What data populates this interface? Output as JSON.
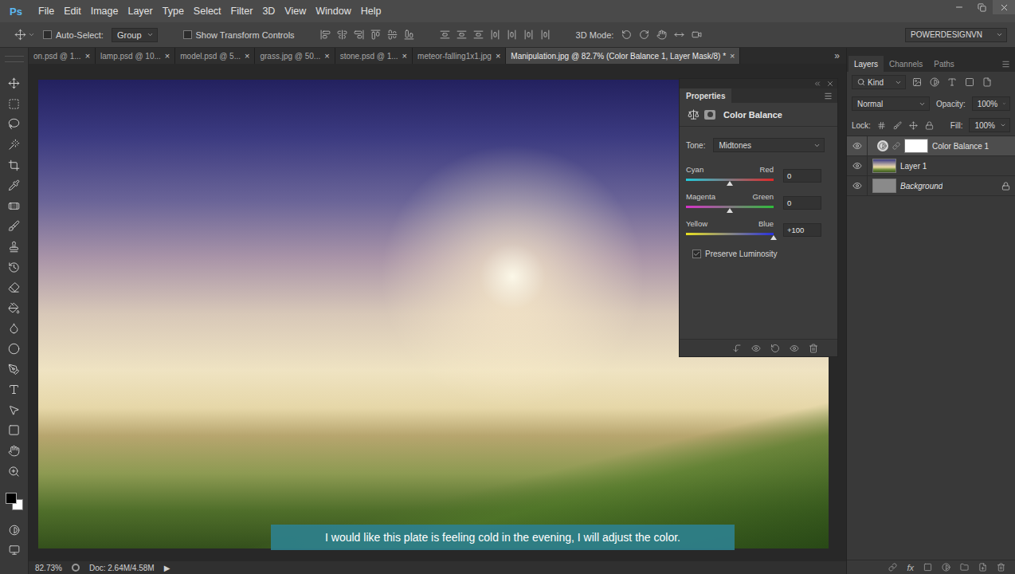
{
  "app": {
    "logo": "Ps"
  },
  "menu": [
    "File",
    "Edit",
    "Image",
    "Layer",
    "Type",
    "Select",
    "Filter",
    "3D",
    "View",
    "Window",
    "Help"
  ],
  "options_bar": {
    "auto_select": {
      "label": "Auto-Select:",
      "checked": false
    },
    "auto_select_target": "Group",
    "show_transform": {
      "label": "Show Transform Controls",
      "checked": false
    },
    "mode_3d_label": "3D Mode:",
    "workspace": "POWERDESIGNVN"
  },
  "document_tabs": [
    {
      "label": "on.psd @ 1...",
      "selected": false,
      "close": "×"
    },
    {
      "label": "lamp.psd @ 10...",
      "selected": false,
      "close": "×"
    },
    {
      "label": "model.psd @ 5...",
      "selected": false,
      "close": "×"
    },
    {
      "label": "grass.jpg @ 50...",
      "selected": false,
      "close": "×"
    },
    {
      "label": "stone.psd @ 1...",
      "selected": false,
      "close": "×"
    },
    {
      "label": "meteor-falling1x1.jpg",
      "selected": false,
      "close": "×"
    },
    {
      "label": "Manipulation.jpg @ 82.7% (Color Balance 1, Layer Mask/8) *",
      "selected": true,
      "close": "×"
    }
  ],
  "tabs_overflow": "»",
  "subtitle": "I would like this plate is feeling cold in the evening, I will adjust the color.",
  "properties": {
    "title": "Properties",
    "adjustment": "Color Balance",
    "tone_label": "Tone:",
    "tone": "Midtones",
    "sliders": [
      {
        "left": "Cyan",
        "right": "Red",
        "value": "0",
        "level": 0.5
      },
      {
        "left": "Magenta",
        "right": "Green",
        "value": "0",
        "level": 0.5
      },
      {
        "left": "Yellow",
        "right": "Blue",
        "value": "+100",
        "level": 1
      }
    ],
    "preserve_luminosity": {
      "label": "Preserve Luminosity",
      "checked": true
    }
  },
  "layers_panel": {
    "tabs": [
      {
        "label": "Layers",
        "selected": true
      },
      {
        "label": "Channels",
        "selected": false
      },
      {
        "label": "Paths",
        "selected": false
      }
    ],
    "filter": "Kind",
    "blend_mode": "Normal",
    "opacity_label": "Opacity:",
    "opacity": "100%",
    "lock_label": "Lock:",
    "fill_label": "Fill:",
    "fill": "100%",
    "layers": [
      {
        "name": "Color Balance 1",
        "kind": "adjustment",
        "selected": true,
        "visible": true,
        "locked": false
      },
      {
        "name": "Layer 1",
        "kind": "image",
        "selected": false,
        "visible": true,
        "locked": false
      },
      {
        "name": "Background",
        "kind": "fill",
        "selected": false,
        "visible": true,
        "locked": true
      }
    ],
    "footer_fx": "fx"
  },
  "status_bar": {
    "zoom": "82.73%",
    "doc": "Doc: 2.64M/4.58M",
    "arrow": "▶"
  }
}
